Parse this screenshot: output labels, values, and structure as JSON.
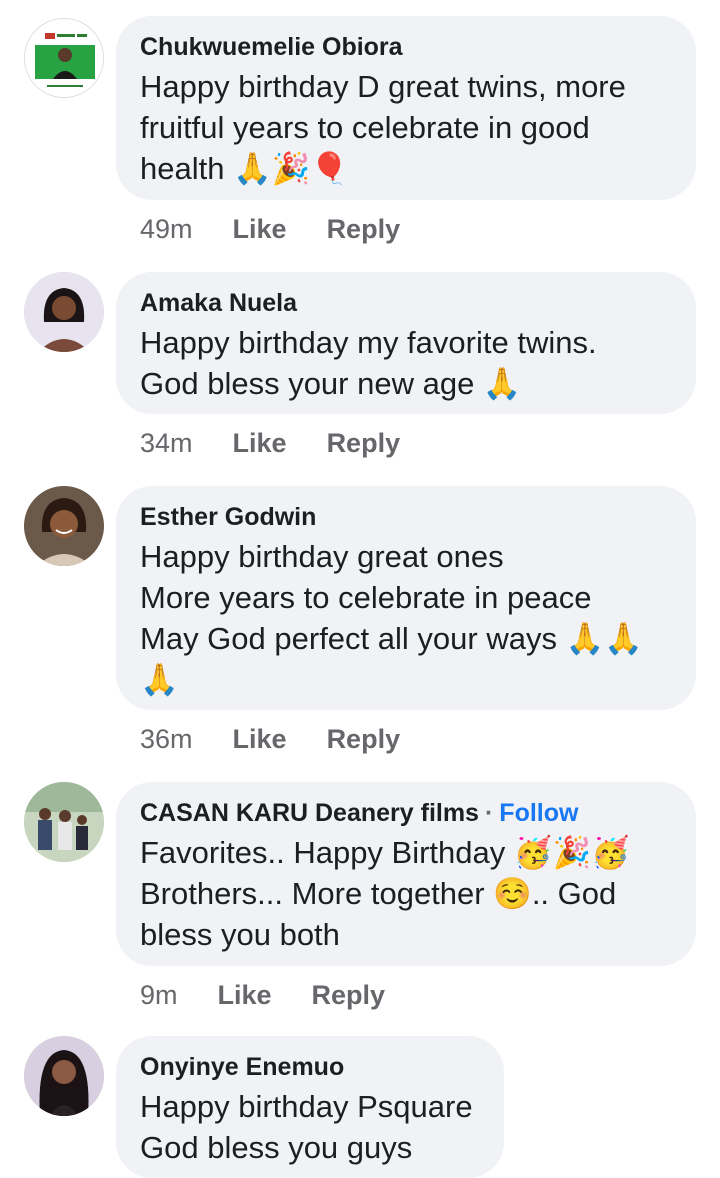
{
  "comments": [
    {
      "name": "Chukwuemelie Obiora",
      "lines": [
        "Happy birthday D great twins, more",
        "fruitful years to celebrate in good",
        "health 🙏🎉🎈"
      ],
      "time": "49m",
      "like": "Like",
      "reply": "Reply"
    },
    {
      "name": "Amaka Nuela",
      "lines": [
        "Happy birthday my favorite twins.",
        "God bless your new age 🙏"
      ],
      "time": "34m",
      "like": "Like",
      "reply": "Reply"
    },
    {
      "name": "Esther Godwin",
      "lines": [
        "Happy birthday great ones",
        "More years to celebrate in peace",
        "May God perfect all your ways 🙏🙏",
        "🙏"
      ],
      "time": "36m",
      "like": "Like",
      "reply": "Reply"
    },
    {
      "name": "CASAN KARU Deanery films",
      "separator": "·",
      "follow": "Follow",
      "lines": [
        "Favorites.. Happy Birthday 🥳🎉🥳",
        "Brothers... More together ☺️.. God",
        "bless you both"
      ],
      "time": "9m",
      "like": "Like",
      "reply": "Reply"
    },
    {
      "name": "Onyinye Enemuo",
      "lines": [
        "Happy birthday Psquare",
        "God bless you guys"
      ]
    }
  ],
  "icons": {
    "avatar1": "labour-party-poster-avatar",
    "avatar2": "woman-avatar",
    "avatar3": "smiling-woman-avatar",
    "avatar4": "outdoor-group-avatar",
    "avatar5": "woman-long-hair-avatar"
  },
  "colors": {
    "bubble": "#f0f2f5",
    "follow": "#1877f2",
    "meta": "#65676b",
    "text": "#1c1e21"
  }
}
